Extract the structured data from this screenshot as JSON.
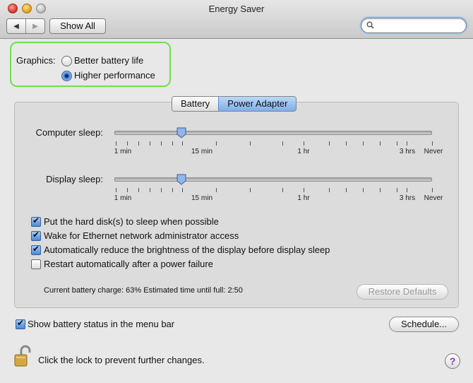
{
  "window": {
    "title": "Energy Saver"
  },
  "toolbar": {
    "show_all_label": "Show All",
    "search_placeholder": ""
  },
  "graphics": {
    "label": "Graphics:",
    "options": [
      {
        "label": "Better battery life",
        "selected": false
      },
      {
        "label": "Higher performance",
        "selected": true
      }
    ]
  },
  "tabs": [
    {
      "label": "Battery",
      "selected": false
    },
    {
      "label": "Power Adapter",
      "selected": true
    }
  ],
  "sliders": {
    "computer_sleep": {
      "label": "Computer sleep:",
      "value_text": "15 min"
    },
    "display_sleep": {
      "label": "Display sleep:",
      "value_text": "15 min"
    },
    "tick_labels": [
      "1 min",
      "15 min",
      "1 hr",
      "3 hrs",
      "Never"
    ]
  },
  "options": [
    {
      "label": "Put the hard disk(s) to sleep when possible",
      "checked": true
    },
    {
      "label": "Wake for Ethernet network administrator access",
      "checked": true
    },
    {
      "label": "Automatically reduce the brightness of the display before display sleep",
      "checked": true
    },
    {
      "label": "Restart automatically after a power failure",
      "checked": false
    }
  ],
  "status": {
    "text": "Current battery charge: 63%  Estimated time until full: 2:50"
  },
  "buttons": {
    "restore_defaults": "Restore Defaults",
    "schedule": "Schedule..."
  },
  "menu_bar_option": {
    "label": "Show battery status in the menu bar",
    "checked": true
  },
  "lock": {
    "text": "Click the lock to prevent further changes."
  },
  "help": {
    "label": "?"
  },
  "colors": {
    "highlight_green": "#6fe04a",
    "accent_blue": "#4a87d8"
  }
}
